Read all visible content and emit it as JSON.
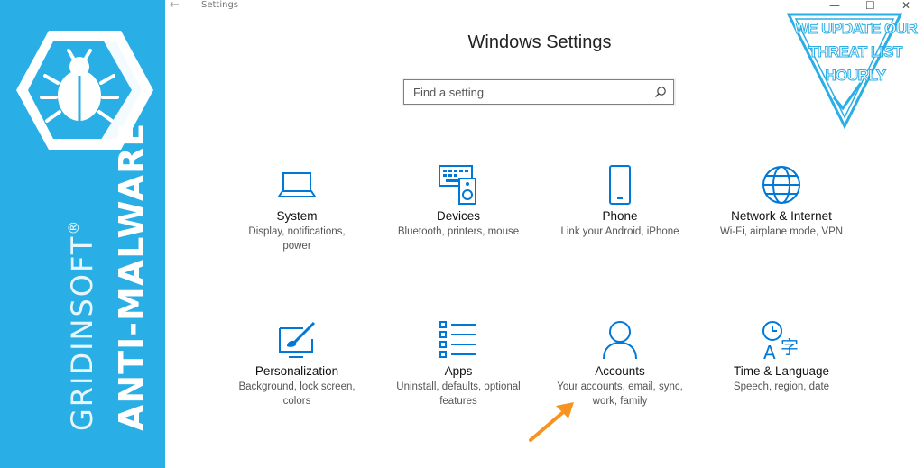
{
  "sidebar": {
    "brand_product": "ANTI-MALWARE",
    "brand_company": "GRIDINSOFT",
    "trademark": "®"
  },
  "window": {
    "title": "Settings",
    "controls": [
      "—",
      "☐",
      "✕"
    ]
  },
  "header": {
    "title": "Windows Settings"
  },
  "search": {
    "placeholder": "Find a setting"
  },
  "tiles": [
    {
      "name": "System",
      "desc": "Display, notifications, power",
      "icon": "laptop-icon"
    },
    {
      "name": "Devices",
      "desc": "Bluetooth, printers, mouse",
      "icon": "devices-icon"
    },
    {
      "name": "Phone",
      "desc": "Link your Android, iPhone",
      "icon": "phone-icon"
    },
    {
      "name": "Network & Internet",
      "desc": "Wi-Fi, airplane mode, VPN",
      "icon": "globe-icon"
    },
    {
      "name": "Personalization",
      "desc": "Background, lock screen, colors",
      "icon": "paint-icon"
    },
    {
      "name": "Apps",
      "desc": "Uninstall, defaults, optional features",
      "icon": "apps-list-icon"
    },
    {
      "name": "Accounts",
      "desc": "Your accounts, email, sync, work, family",
      "icon": "person-icon"
    },
    {
      "name": "Time & Language",
      "desc": "Speech, region, date",
      "icon": "time-language-icon"
    }
  ],
  "badge": {
    "lines": [
      "WE UPDATE OUR",
      "THREAT LIST",
      "HOURLY"
    ]
  },
  "colors": {
    "brand": "#29aee6",
    "accent": "#0078d7",
    "arrow": "#f7931e"
  }
}
